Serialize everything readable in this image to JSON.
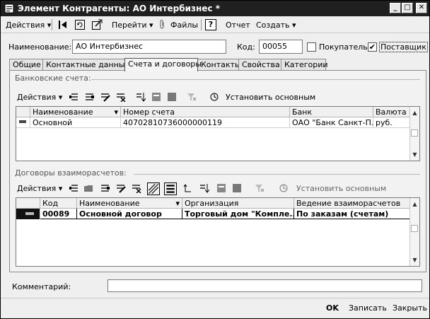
{
  "window": {
    "title": "Элемент Контрагенты: АО Интербизнес *",
    "minimize": "_",
    "maximize": "□",
    "close": "✕"
  },
  "toolbar": {
    "actions": "Действия",
    "goto": "Перейти",
    "files": "Файлы",
    "help": "?",
    "report": "Отчет",
    "create": "Создать"
  },
  "form": {
    "name_label": "Наименование:",
    "name_value": "АО Интербизнес",
    "code_label": "Код:",
    "code_value": "00055",
    "buyer_label": "Покупатель",
    "buyer_checked": false,
    "supplier_label": "Поставщик",
    "supplier_checked": true
  },
  "tabs": [
    {
      "label": "Общие"
    },
    {
      "label": "Контактные данные"
    },
    {
      "label": "Счета и договоры",
      "active": true
    },
    {
      "label": "Контакты"
    },
    {
      "label": "Свойства"
    },
    {
      "label": "Категории"
    }
  ],
  "bank_accounts": {
    "title": "Банковские счета:",
    "actions": "Действия",
    "set_main": "Установить основным",
    "columns": [
      "Наименование",
      "Номер счета",
      "Банк",
      "Валюта"
    ],
    "rows": [
      [
        "Основной",
        "40702810736000000119",
        "ОАО \"Банк Санкт-П...",
        "руб."
      ]
    ]
  },
  "contracts": {
    "title": "Договоры взаиморасчетов:",
    "actions": "Действия",
    "set_main": "Установить основным",
    "columns": [
      "Код",
      "Наименование",
      "Организация",
      "Ведение взаиморасчетов"
    ],
    "rows": [
      [
        "00089",
        "Основной договор",
        "Торговый дом \"Компле...",
        "По заказам (счетам)"
      ]
    ]
  },
  "comment": {
    "label": "Комментарий:",
    "value": ""
  },
  "footer": {
    "ok": "OK",
    "save": "Записать",
    "close": "Закрыть"
  }
}
